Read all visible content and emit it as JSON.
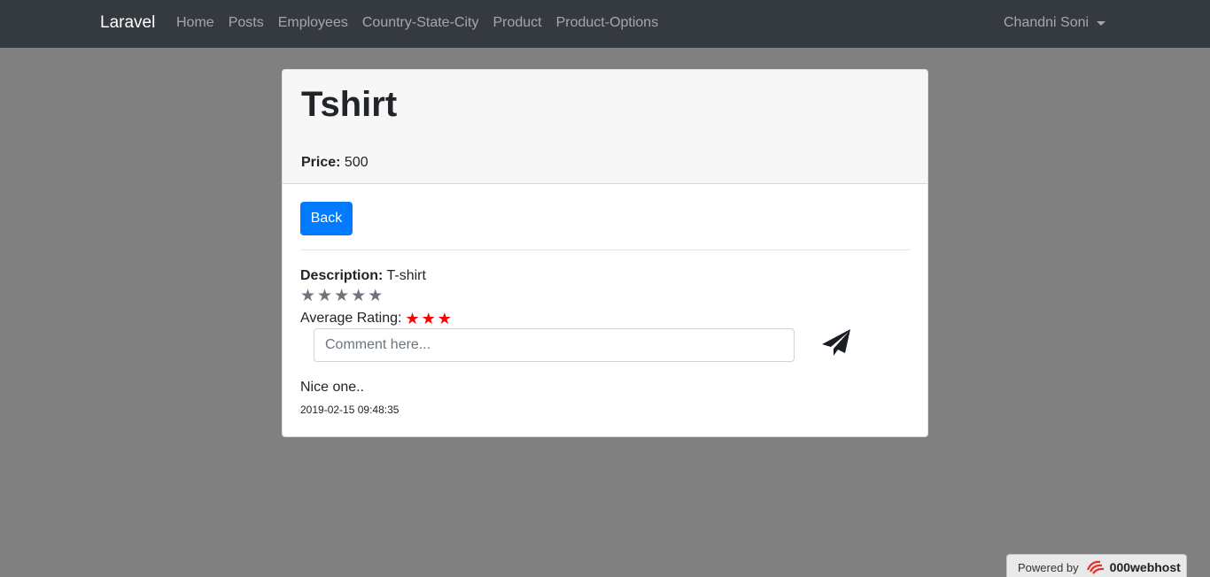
{
  "navbar": {
    "brand": "Laravel",
    "links": [
      "Home",
      "Posts",
      "Employees",
      "Country-State-City",
      "Product",
      "Product-Options"
    ],
    "user": "Chandni Soni"
  },
  "product": {
    "title": "Tshirt",
    "price_label": "Price:",
    "price": "500",
    "back_label": "Back",
    "description_label": "Description:",
    "description": "T-shirt",
    "rating_stars": 5,
    "average_rating_label": "Average Rating:",
    "average_rating": 3,
    "comment_placeholder": "Comment here..."
  },
  "comments": [
    {
      "text": "Nice one..",
      "timestamp": "2019-02-15 09:48:35"
    }
  ],
  "footer": {
    "powered_by": "Powered by",
    "host": "000webhost"
  },
  "colors": {
    "navbar_bg": "#343a40",
    "primary": "#007bff",
    "rating_star": "#ff0000",
    "empty_star": "#6c757d"
  },
  "icons": {
    "send": "paper-plane-icon",
    "star": "star-icon",
    "caret": "caret-down-icon"
  }
}
